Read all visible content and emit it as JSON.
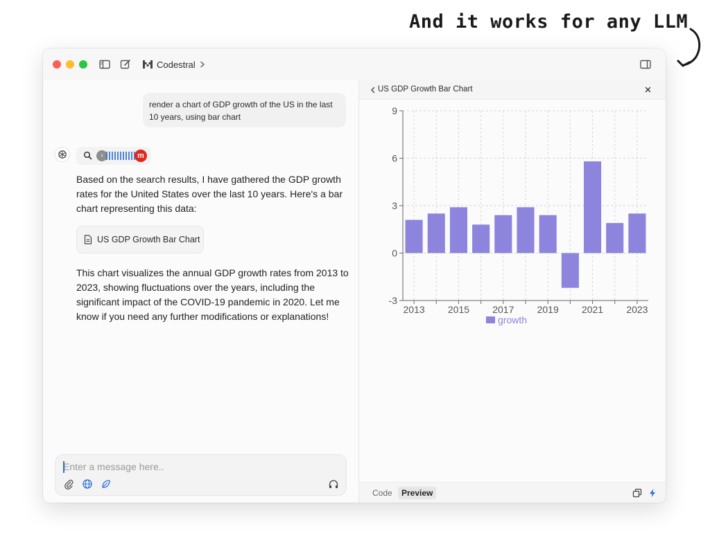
{
  "banner": {
    "text": "And it works for any LLM"
  },
  "titlebar": {
    "model_name": "Codestral"
  },
  "chat": {
    "user_message": "render a chart of GDP growth of the US in the last 10 years, using bar chart",
    "tool_badge_letter": "m",
    "bot_paragraph_1": "Based on the search results, I have gathered the GDP growth rates for the United States over the last 10 years. Here's a bar chart representing this data:",
    "artifact_card_label": "US GDP Growth Bar Chart",
    "bot_paragraph_2": "This chart visualizes the annual GDP growth rates from 2013 to 2023, showing fluctuations over the years, including the significant impact of the COVID-19 pandemic in 2020. Let me know if you need any further modifications or explanations!"
  },
  "composer": {
    "placeholder": "Enter a message here.."
  },
  "artifact": {
    "title": "US GDP Growth Bar Chart",
    "tabs": {
      "code": "Code",
      "preview": "Preview"
    }
  },
  "colors": {
    "bar": "#8c84dd",
    "accent": "#2f6fd4"
  },
  "chart_data": {
    "type": "bar",
    "categories": [
      "2013",
      "2014",
      "2015",
      "2016",
      "2017",
      "2018",
      "2019",
      "2020",
      "2021",
      "2022",
      "2023"
    ],
    "series": [
      {
        "name": "growth",
        "values": [
          2.1,
          2.5,
          2.9,
          1.8,
          2.4,
          2.9,
          2.4,
          -2.2,
          5.8,
          1.9,
          2.5
        ]
      }
    ],
    "ylim": [
      -3,
      9
    ],
    "yticks": [
      "-3",
      "0",
      "3",
      "6",
      "9"
    ],
    "xticks": [
      "2013",
      "2015",
      "2017",
      "2019",
      "2021",
      "2023"
    ],
    "grid": true,
    "legend": "bottom-center"
  }
}
